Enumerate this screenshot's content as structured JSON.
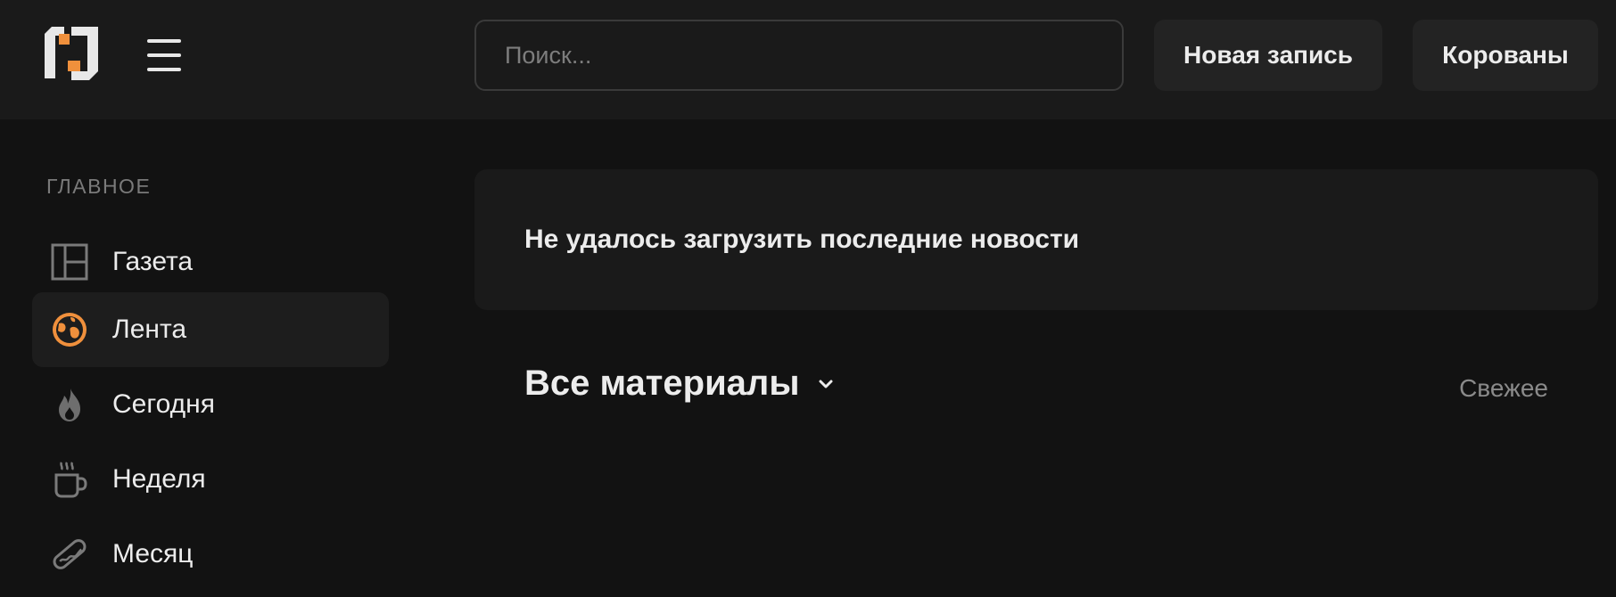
{
  "header": {
    "search_placeholder": "Поиск...",
    "new_post_label": "Новая запись",
    "korovany_label": "Корованы"
  },
  "sidebar": {
    "heading": "ГЛАВНОЕ",
    "items": [
      {
        "label": "Газета",
        "icon": "newspaper-layout-icon"
      },
      {
        "label": "Лента",
        "icon": "globe-icon",
        "active": true
      },
      {
        "label": "Сегодня",
        "icon": "flame-icon"
      },
      {
        "label": "Неделя",
        "icon": "coffee-cup-icon"
      },
      {
        "label": "Месяц",
        "icon": "hotdog-icon"
      }
    ]
  },
  "main": {
    "error_message": "Не удалось загрузить последние новости",
    "feed_title": "Все материалы",
    "sort_label": "Свежее"
  },
  "colors": {
    "accent": "#f0903c",
    "background": "#121212",
    "header_bg": "#1a1a1a"
  }
}
